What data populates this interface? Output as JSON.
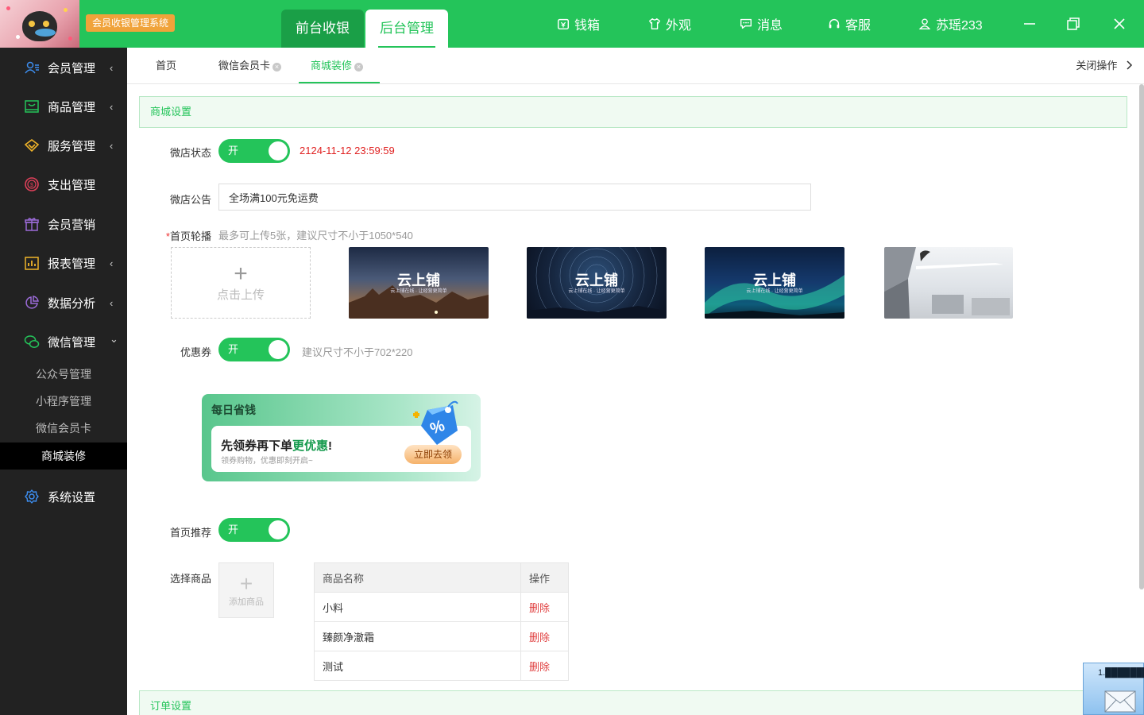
{
  "header": {
    "app_badge": "会员收银管理系统",
    "main_tabs": [
      {
        "label": "前台收银",
        "active": false
      },
      {
        "label": "后台管理",
        "active": true
      }
    ],
    "nav": [
      {
        "label": "钱箱",
        "icon": "cash-box-icon"
      },
      {
        "label": "外观",
        "icon": "shirt-icon"
      },
      {
        "label": "消息",
        "icon": "message-icon"
      },
      {
        "label": "客服",
        "icon": "headset-icon"
      },
      {
        "label": "苏瑶233",
        "icon": "user-icon"
      }
    ],
    "accent_color": "#24c45a"
  },
  "sidebar": {
    "items": [
      {
        "label": "会员管理",
        "icon": "members-icon",
        "arrow": "‹"
      },
      {
        "label": "商品管理",
        "icon": "goods-icon",
        "arrow": "‹"
      },
      {
        "label": "服务管理",
        "icon": "service-icon",
        "arrow": "‹"
      },
      {
        "label": "支出管理",
        "icon": "expense-icon",
        "arrow": ""
      },
      {
        "label": "会员营销",
        "icon": "gift-icon",
        "arrow": ""
      },
      {
        "label": "报表管理",
        "icon": "report-icon",
        "arrow": "‹"
      },
      {
        "label": "数据分析",
        "icon": "pie-chart-icon",
        "arrow": "‹"
      },
      {
        "label": "微信管理",
        "icon": "wechat-icon",
        "arrow": "⌄"
      },
      {
        "label": "系统设置",
        "icon": "gear-icon",
        "arrow": ""
      }
    ],
    "wechat_sub": [
      {
        "label": "公众号管理",
        "active": false
      },
      {
        "label": "小程序管理",
        "active": false
      },
      {
        "label": "微信会员卡",
        "active": false
      },
      {
        "label": "商城装修",
        "active": true
      }
    ]
  },
  "page_tabs": {
    "tabs": [
      {
        "label": "首页",
        "closable": false,
        "active": false
      },
      {
        "label": "微信会员卡",
        "closable": true,
        "active": false
      },
      {
        "label": "商城装修",
        "closable": true,
        "active": true
      }
    ],
    "close_ops": "关闭操作",
    "close_x": "×"
  },
  "shop_settings": {
    "section_title": "商城设置",
    "store_status": {
      "label": "微店状态",
      "value": "开",
      "expire": "2124-11-12 23:59:59"
    },
    "notice": {
      "label": "微店公告",
      "value": "全场满100元免运费"
    },
    "carousel": {
      "label": "首页轮播",
      "required_mark": "*",
      "hint": "最多可上传5张，建议尺寸不小于1050*540",
      "upload_plus": "+",
      "upload_text": "点击上传",
      "banners": [
        {
          "title": "云上铺",
          "subtitle": "云上铺在线 · 让经营更简单"
        },
        {
          "title": "云上铺",
          "subtitle": "云上铺在线 · 让经营更简单"
        },
        {
          "title": "云上铺",
          "subtitle": "云上铺在线 · 让经营更简单"
        },
        {
          "title": "",
          "subtitle": ""
        }
      ]
    },
    "coupon": {
      "label": "优惠券",
      "value": "开",
      "hint": "建议尺寸不小于702*220",
      "preview": {
        "title": "每日省钱",
        "main_a": "先领券再下单",
        "main_b": "更优惠",
        "main_c": "!",
        "sub": "领券购物，优惠即刻开启~",
        "button": "立即去领"
      }
    },
    "recommend": {
      "label": "首页推荐",
      "value": "开"
    },
    "goods": {
      "label": "选择商品",
      "add_plus": "+",
      "add_text": "添加商品",
      "columns": [
        "商品名称",
        "操作"
      ],
      "rows": [
        {
          "name": "小料",
          "op": "删除"
        },
        {
          "name": "臻颜净澈霜",
          "op": "删除"
        },
        {
          "name": "测试",
          "op": "删除"
        }
      ]
    }
  },
  "order_settings": {
    "section_title": "订单设置"
  },
  "notification": {
    "text": "1.████████:05"
  }
}
